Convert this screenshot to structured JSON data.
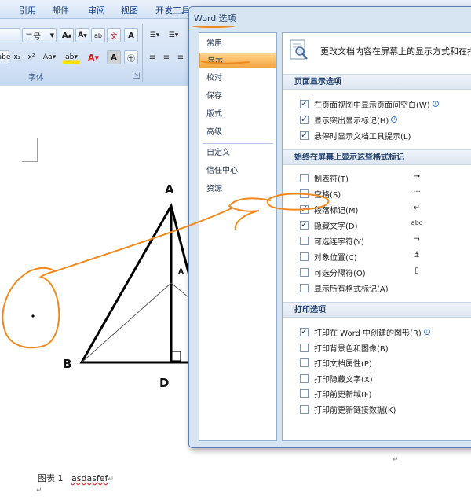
{
  "ribbon": {
    "tabs": [
      "引用",
      "邮件",
      "审阅",
      "视图",
      "开发工具"
    ],
    "font_size": "二号",
    "group_label": "字体"
  },
  "document": {
    "labels": {
      "A": "A",
      "B": "B",
      "D": "D",
      "A_small": "A"
    },
    "caption_prefix": "图表 1",
    "caption_text": "asdasfef",
    "para_mark": "↵"
  },
  "dialog": {
    "title": "Word 选项",
    "nav": [
      "常用",
      "显示",
      "校对",
      "保存",
      "版式",
      "高级",
      "自定义",
      "信任中心",
      "资源"
    ],
    "active_nav": "显示",
    "header": "更改文档内容在屏幕上的显示方式和在打印",
    "sections": {
      "page_display": {
        "title": "页面显示选项",
        "options": [
          {
            "label": "在页面视图中显示页面间空白(W)",
            "checked": true,
            "info": true
          },
          {
            "label": "显示突出显示标记(H)",
            "checked": true,
            "info": true
          },
          {
            "label": "悬停时显示文档工具提示(L)",
            "checked": true,
            "info": false
          }
        ]
      },
      "format_marks": {
        "title": "始终在屏幕上显示这些格式标记",
        "options": [
          {
            "label": "制表符(T)",
            "checked": false,
            "symbol": "→"
          },
          {
            "label": "空格(S)",
            "checked": false,
            "symbol": "···"
          },
          {
            "label": "段落标记(M)",
            "checked": true,
            "symbol": "↵"
          },
          {
            "label": "隐藏文字(D)",
            "checked": true,
            "symbol": "abc"
          },
          {
            "label": "可选连字符(Y)",
            "checked": false,
            "symbol": "¬"
          },
          {
            "label": "对象位置(C)",
            "checked": false,
            "symbol": "⚓"
          },
          {
            "label": "可选分隔符(O)",
            "checked": false,
            "symbol": "▯"
          },
          {
            "label": "显示所有格式标记(A)",
            "checked": false,
            "symbol": ""
          }
        ]
      },
      "print": {
        "title": "打印选项",
        "options": [
          {
            "label": "打印在 Word 中创建的图形(R)",
            "checked": true,
            "info": true
          },
          {
            "label": "打印背景色和图像(B)",
            "checked": false,
            "info": false
          },
          {
            "label": "打印文档属性(P)",
            "checked": false,
            "info": false
          },
          {
            "label": "打印隐藏文字(X)",
            "checked": false,
            "info": false
          },
          {
            "label": "打印前更新域(F)",
            "checked": false,
            "info": false
          },
          {
            "label": "打印前更新链接数据(K)",
            "checked": false,
            "info": false
          }
        ]
      }
    }
  },
  "colors": {
    "annotation": "#f08a1e",
    "active_nav": "#f7a53c",
    "ribbon": "#d2e1f4"
  }
}
